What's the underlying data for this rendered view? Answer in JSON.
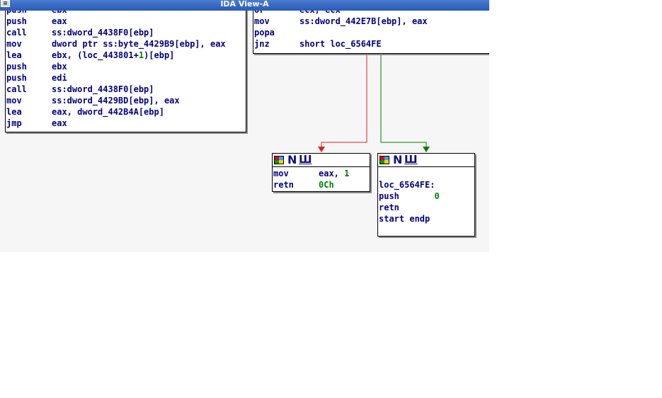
{
  "window": {
    "title": "IDA View-A",
    "sysmenu_icon": "window-menu-icon"
  },
  "colors": {
    "code_text": "#000080",
    "immediate": "#008000",
    "edge_false": "#e02020",
    "edge_true": "#008000",
    "titlebar": "#2a5bb7"
  },
  "nodes": {
    "left": {
      "lines": [
        {
          "mnemonic": "push",
          "operand": "ebx"
        },
        {
          "mnemonic": "push",
          "operand": "eax"
        },
        {
          "mnemonic": "call",
          "operand": "ss:dword_4438F0[ebp]"
        },
        {
          "mnemonic": "mov",
          "operand": "dword ptr ss:byte_4429B9[ebp], eax"
        },
        {
          "mnemonic": "lea",
          "operand_pre": "ebx, (loc_443801+",
          "operand_num": "1",
          "operand_post": ")[ebp]"
        },
        {
          "mnemonic": "push",
          "operand": "ebx"
        },
        {
          "mnemonic": "push",
          "operand": "edi"
        },
        {
          "mnemonic": "call",
          "operand": "ss:dword_4438F0[ebp]"
        },
        {
          "mnemonic": "mov",
          "operand": "ss:dword_4429BD[ebp], eax"
        },
        {
          "mnemonic": "lea",
          "operand": "eax, dword_442B4A[ebp]"
        },
        {
          "mnemonic": "jmp",
          "operand": "eax"
        }
      ]
    },
    "right": {
      "lines": [
        {
          "mnemonic": "or",
          "operand": "ecx, ecx"
        },
        {
          "mnemonic": "mov",
          "operand": "ss:dword_442E7B[ebp], eax"
        },
        {
          "mnemonic": "popa",
          "operand": ""
        },
        {
          "mnemonic": "jnz",
          "operand": "short loc_6564FE"
        }
      ]
    },
    "false_branch": {
      "header": {
        "icons": [
          "color-grid-icon",
          "n-node-icon",
          "w-node-icon"
        ],
        "n": "N",
        "w": "Ш"
      },
      "lines": [
        {
          "mnemonic": "mov",
          "operand_pre": "eax, ",
          "operand_num": "1"
        },
        {
          "mnemonic": "retn",
          "operand_num": "0Ch"
        }
      ]
    },
    "true_branch": {
      "header": {
        "icons": [
          "color-grid-icon",
          "n-node-icon",
          "w-node-icon"
        ],
        "n": "N",
        "w": "Ш"
      },
      "lines": [
        {
          "text": ""
        },
        {
          "text": "loc_6564FE:"
        },
        {
          "mnemonic": "push",
          "operand_num": "0",
          "operand_pad": "  "
        },
        {
          "mnemonic": "retn",
          "operand": ""
        },
        {
          "text": "start endp"
        }
      ]
    }
  }
}
